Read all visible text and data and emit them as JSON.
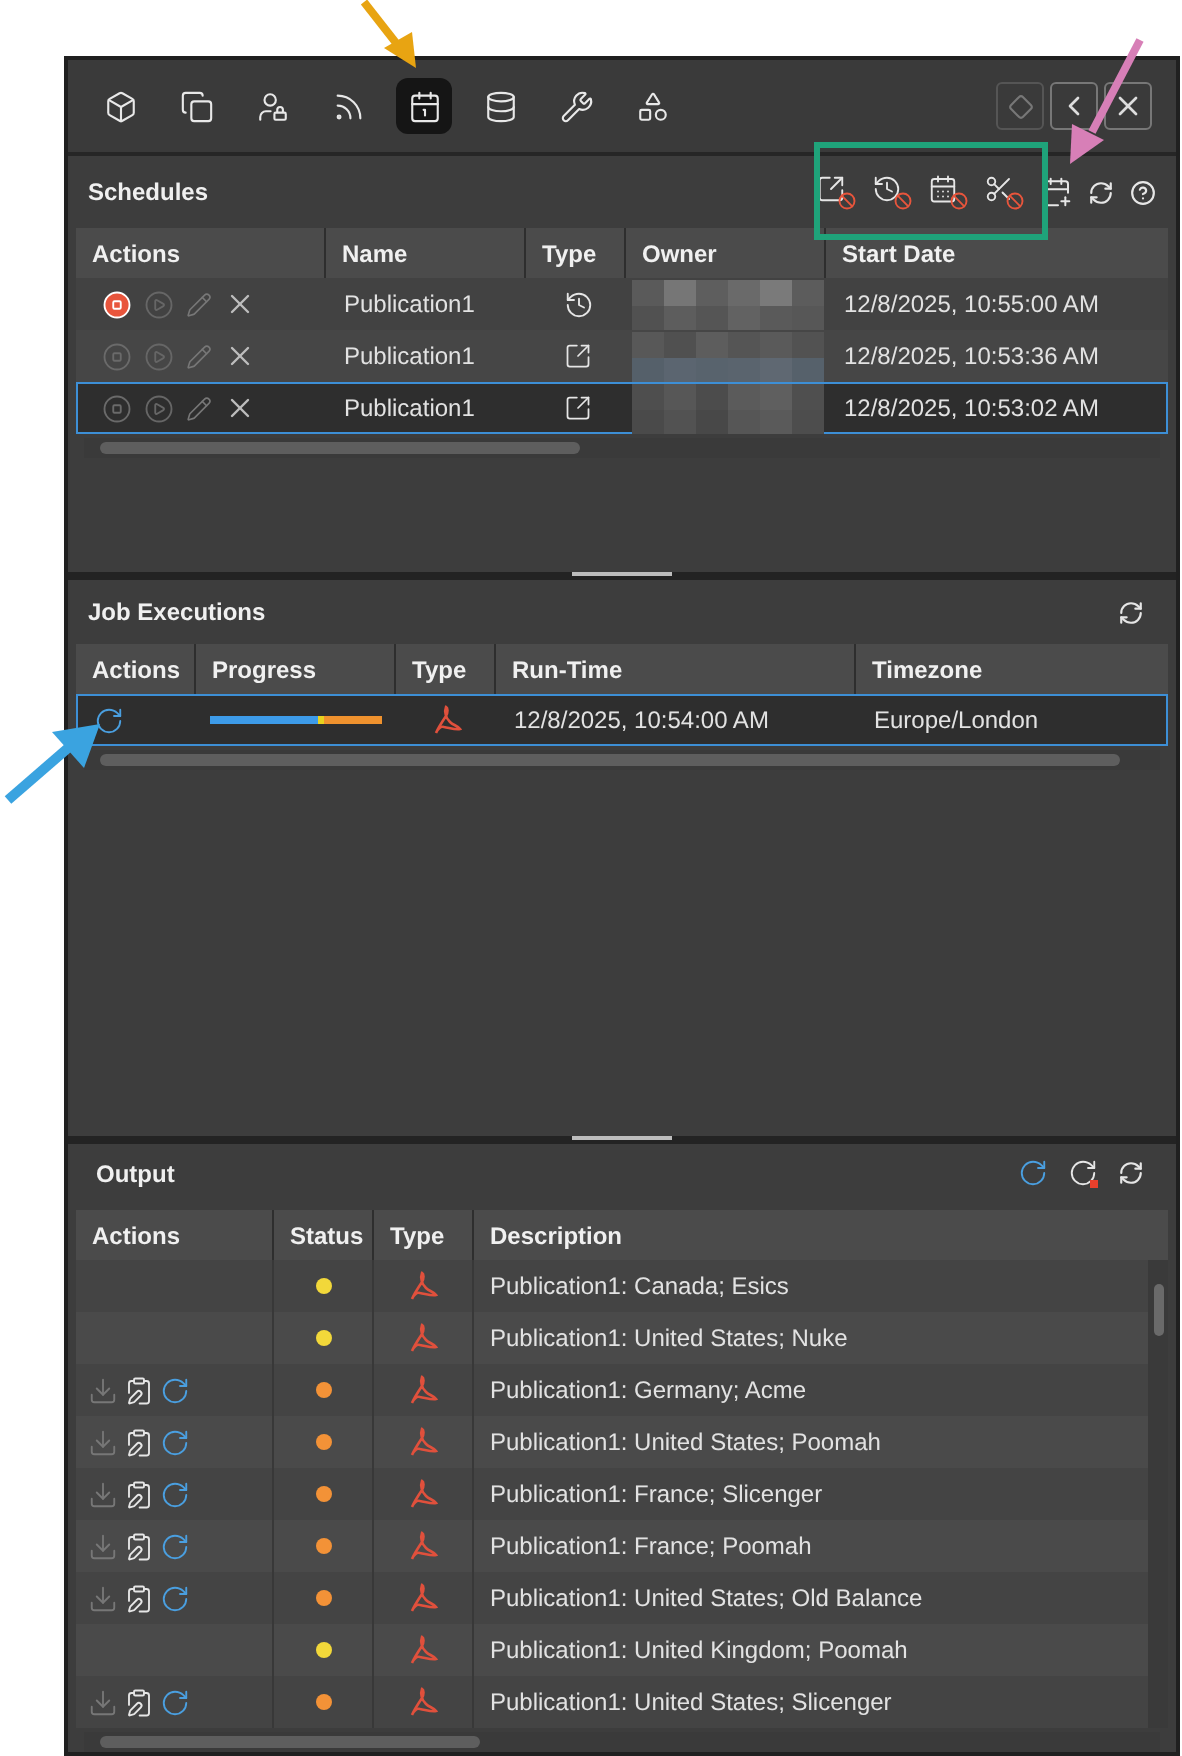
{
  "toolbar": {
    "tools": [
      {
        "selected": false
      },
      {
        "selected": false
      },
      {
        "selected": false
      },
      {
        "selected": false
      },
      {
        "selected": true
      },
      {
        "selected": false
      },
      {
        "selected": false
      },
      {
        "selected": false
      }
    ]
  },
  "schedules": {
    "title": "Schedules",
    "columns": [
      "Actions",
      "Name",
      "Type",
      "Owner",
      "Start Date"
    ],
    "rows": [
      {
        "active": true,
        "name": "Publication1",
        "kind": "recurring",
        "start_date": "12/8/2025, 10:55:00 AM",
        "selected": false
      },
      {
        "active": false,
        "name": "Publication1",
        "kind": "once",
        "start_date": "12/8/2025, 10:53:36 AM",
        "selected": false
      },
      {
        "active": false,
        "name": "Publication1",
        "kind": "once",
        "start_date": "12/8/2025, 10:53:02 AM",
        "selected": true
      }
    ]
  },
  "job_executions": {
    "title": "Job Executions",
    "columns": [
      "Actions",
      "Progress",
      "Type",
      "Run-Time",
      "Timezone"
    ],
    "rows": [
      {
        "progress": [
          {
            "color": "#3d9be9",
            "level": 0.63
          },
          {
            "color": "#e8d21e",
            "level": 0.03
          },
          {
            "color": "#f0922e",
            "level": 0.34
          }
        ],
        "run_time": "12/8/2025, 10:54:00 AM",
        "timezone": "Europe/London",
        "selected": true
      }
    ]
  },
  "output": {
    "title": "Output",
    "columns": [
      "Actions",
      "Status",
      "Type",
      "Description"
    ],
    "rows": [
      {
        "actions": false,
        "color": "#f2d83a",
        "description": "Publication1: Canada; Esics"
      },
      {
        "actions": false,
        "color": "#f2d83a",
        "description": "Publication1: United States; Nuke"
      },
      {
        "actions": true,
        "color": "#f39237",
        "description": "Publication1: Germany; Acme"
      },
      {
        "actions": true,
        "color": "#f39237",
        "description": "Publication1: United States; Poomah"
      },
      {
        "actions": true,
        "color": "#f39237",
        "description": "Publication1: France; Slicenger"
      },
      {
        "actions": true,
        "color": "#f39237",
        "description": "Publication1: France; Poomah"
      },
      {
        "actions": true,
        "color": "#f39237",
        "description": "Publication1: United States; Old Balance"
      },
      {
        "actions": false,
        "color": "#f2d83a",
        "description": "Publication1: United Kingdom; Poomah"
      },
      {
        "actions": true,
        "color": "#f39237",
        "description": "Publication1: United States; Slicenger"
      }
    ]
  }
}
